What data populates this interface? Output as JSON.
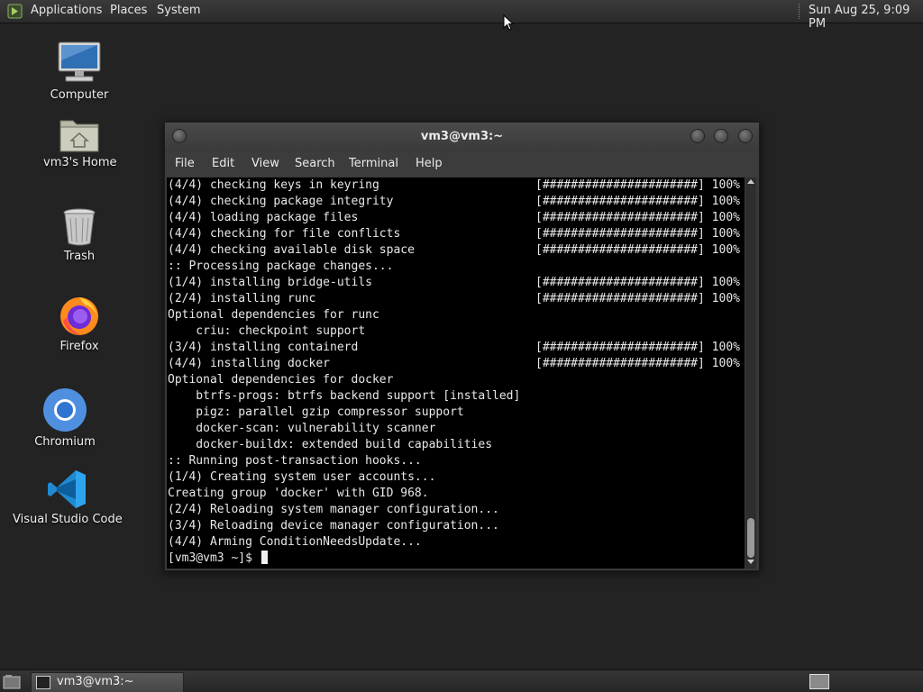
{
  "top_panel": {
    "menu": [
      "Applications",
      "Places",
      "System"
    ],
    "clock": "Sun Aug 25,  9:09 PM"
  },
  "desktop": {
    "icons": [
      {
        "label": "Computer",
        "icon": "computer-icon"
      },
      {
        "label": "vm3's Home",
        "icon": "home-folder-icon"
      },
      {
        "label": "Trash",
        "icon": "trash-icon"
      },
      {
        "label": "Firefox",
        "icon": "firefox-icon"
      },
      {
        "label": "Chromium",
        "icon": "chromium-icon"
      },
      {
        "label": "Visual Studio Code",
        "icon": "vscode-icon"
      }
    ]
  },
  "terminal": {
    "title": "vm3@vm3:~",
    "menu": [
      "File",
      "Edit",
      "View",
      "Search",
      "Terminal",
      "Help"
    ],
    "lines": [
      {
        "text": "(4/4) checking keys in keyring",
        "bar": "[######################] 100%"
      },
      {
        "text": "(4/4) checking package integrity",
        "bar": "[######################] 100%"
      },
      {
        "text": "(4/4) loading package files",
        "bar": "[######################] 100%"
      },
      {
        "text": "(4/4) checking for file conflicts",
        "bar": "[######################] 100%"
      },
      {
        "text": "(4/4) checking available disk space",
        "bar": "[######################] 100%"
      },
      {
        "text": ":: Processing package changes...",
        "bar": ""
      },
      {
        "text": "(1/4) installing bridge-utils",
        "bar": "[######################] 100%"
      },
      {
        "text": "(2/4) installing runc",
        "bar": "[######################] 100%"
      },
      {
        "text": "Optional dependencies for runc",
        "bar": ""
      },
      {
        "text": "    criu: checkpoint support",
        "bar": ""
      },
      {
        "text": "(3/4) installing containerd",
        "bar": "[######################] 100%"
      },
      {
        "text": "(4/4) installing docker",
        "bar": "[######################] 100%"
      },
      {
        "text": "Optional dependencies for docker",
        "bar": ""
      },
      {
        "text": "    btrfs-progs: btrfs backend support [installed]",
        "bar": ""
      },
      {
        "text": "    pigz: parallel gzip compressor support",
        "bar": ""
      },
      {
        "text": "    docker-scan: vulnerability scanner",
        "bar": ""
      },
      {
        "text": "    docker-buildx: extended build capabilities",
        "bar": ""
      },
      {
        "text": ":: Running post-transaction hooks...",
        "bar": ""
      },
      {
        "text": "(1/4) Creating system user accounts...",
        "bar": ""
      },
      {
        "text": "Creating group 'docker' with GID 968.",
        "bar": ""
      },
      {
        "text": "(2/4) Reloading system manager configuration...",
        "bar": ""
      },
      {
        "text": "(3/4) Reloading device manager configuration...",
        "bar": ""
      },
      {
        "text": "(4/4) Arming ConditionNeedsUpdate...",
        "bar": ""
      }
    ],
    "prompt": "[vm3@vm3 ~]$ "
  },
  "taskbar": {
    "window_label": "vm3@vm3:~"
  }
}
